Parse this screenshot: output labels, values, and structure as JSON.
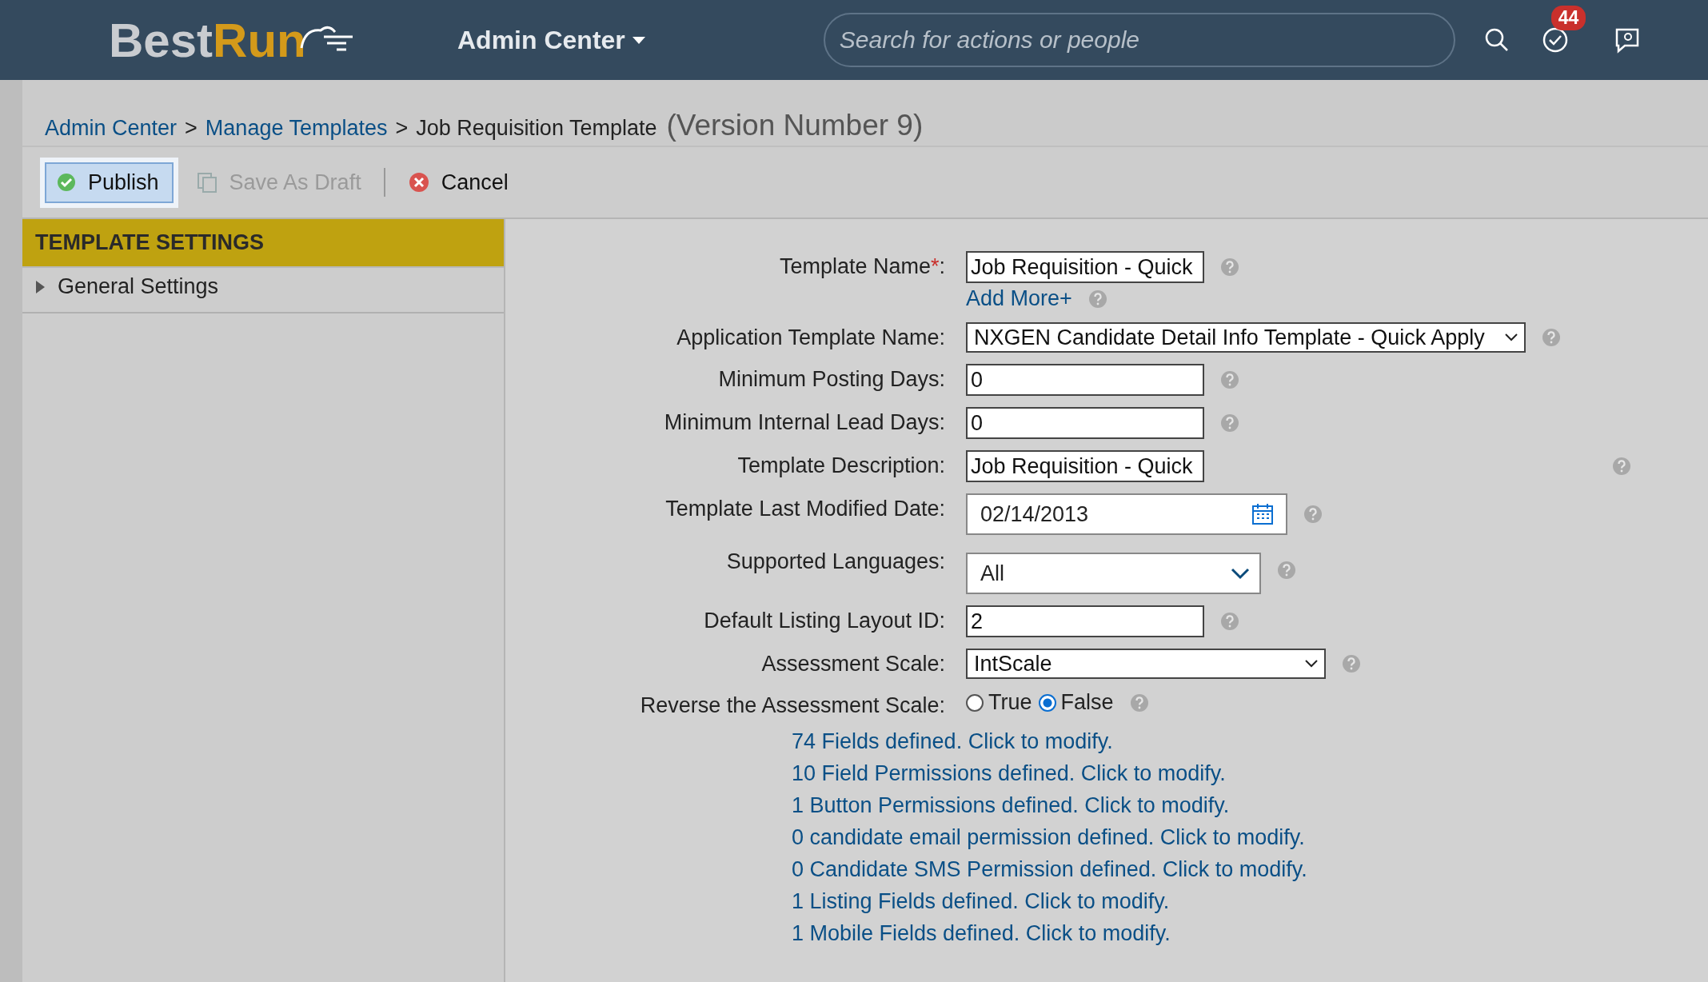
{
  "header": {
    "logo": {
      "first": "Best",
      "second": "Run"
    },
    "menu": "Admin Center",
    "search": {
      "placeholder": "Search for actions or people"
    },
    "badge": "44"
  },
  "breadcrumb": {
    "items": [
      {
        "label": "Admin Center",
        "link": true
      },
      {
        "label": "Manage Templates",
        "link": true
      },
      {
        "label": "Job Requisition Template",
        "link": false
      }
    ],
    "separator": ">",
    "version": "(Version Number 9)"
  },
  "toolbar": [
    {
      "label": "Publish",
      "kind": "primary",
      "disabled": false
    },
    {
      "label": "Save As Draft",
      "kind": "draft",
      "disabled": true
    },
    {
      "label": "Cancel",
      "kind": "cancel",
      "disabled": false
    }
  ],
  "sidebar": {
    "title": "TEMPLATE SETTINGS",
    "items": [
      {
        "label": "General Settings",
        "expanded": false
      }
    ]
  },
  "form": [
    {
      "label": "Template Name",
      "required_mark": "*",
      "label_suffix": ":",
      "kind": "text",
      "value": "Job Requisition - Quick",
      "extra_link": "Add More+"
    },
    {
      "label": "Application Template Name:",
      "kind": "select",
      "value": "NXGEN Candidate Detail Info Template - Quick Apply"
    },
    {
      "label": "Minimum Posting Days:",
      "kind": "text",
      "value": "0"
    },
    {
      "label": "Minimum Internal Lead Days:",
      "kind": "text",
      "value": "0"
    },
    {
      "label": "Template Description:",
      "kind": "text",
      "value": "Job Requisition - Quick"
    },
    {
      "label": "Template Last Modified Date:",
      "kind": "date",
      "value": "02/14/2013"
    },
    {
      "label": "Supported Languages:",
      "kind": "combo",
      "value": "All"
    },
    {
      "label": "Default Listing Layout ID:",
      "kind": "text",
      "value": "2"
    },
    {
      "label": "Assessment Scale:",
      "kind": "select-wide",
      "value": "IntScale"
    },
    {
      "label": "Reverse the Assessment Scale:",
      "kind": "radio",
      "options": [
        {
          "label": "True",
          "selected": false
        },
        {
          "label": "False",
          "selected": true
        }
      ]
    }
  ],
  "links": [
    "74 Fields defined. Click to modify.",
    "10 Field Permissions defined. Click to modify.",
    "1 Button Permissions defined. Click to modify.",
    "0 candidate email permission defined. Click to modify.",
    "0 Candidate SMS Permission defined. Click to modify.",
    "1 Listing Fields defined. Click to modify.",
    "1 Mobile Fields defined. Click to modify."
  ]
}
